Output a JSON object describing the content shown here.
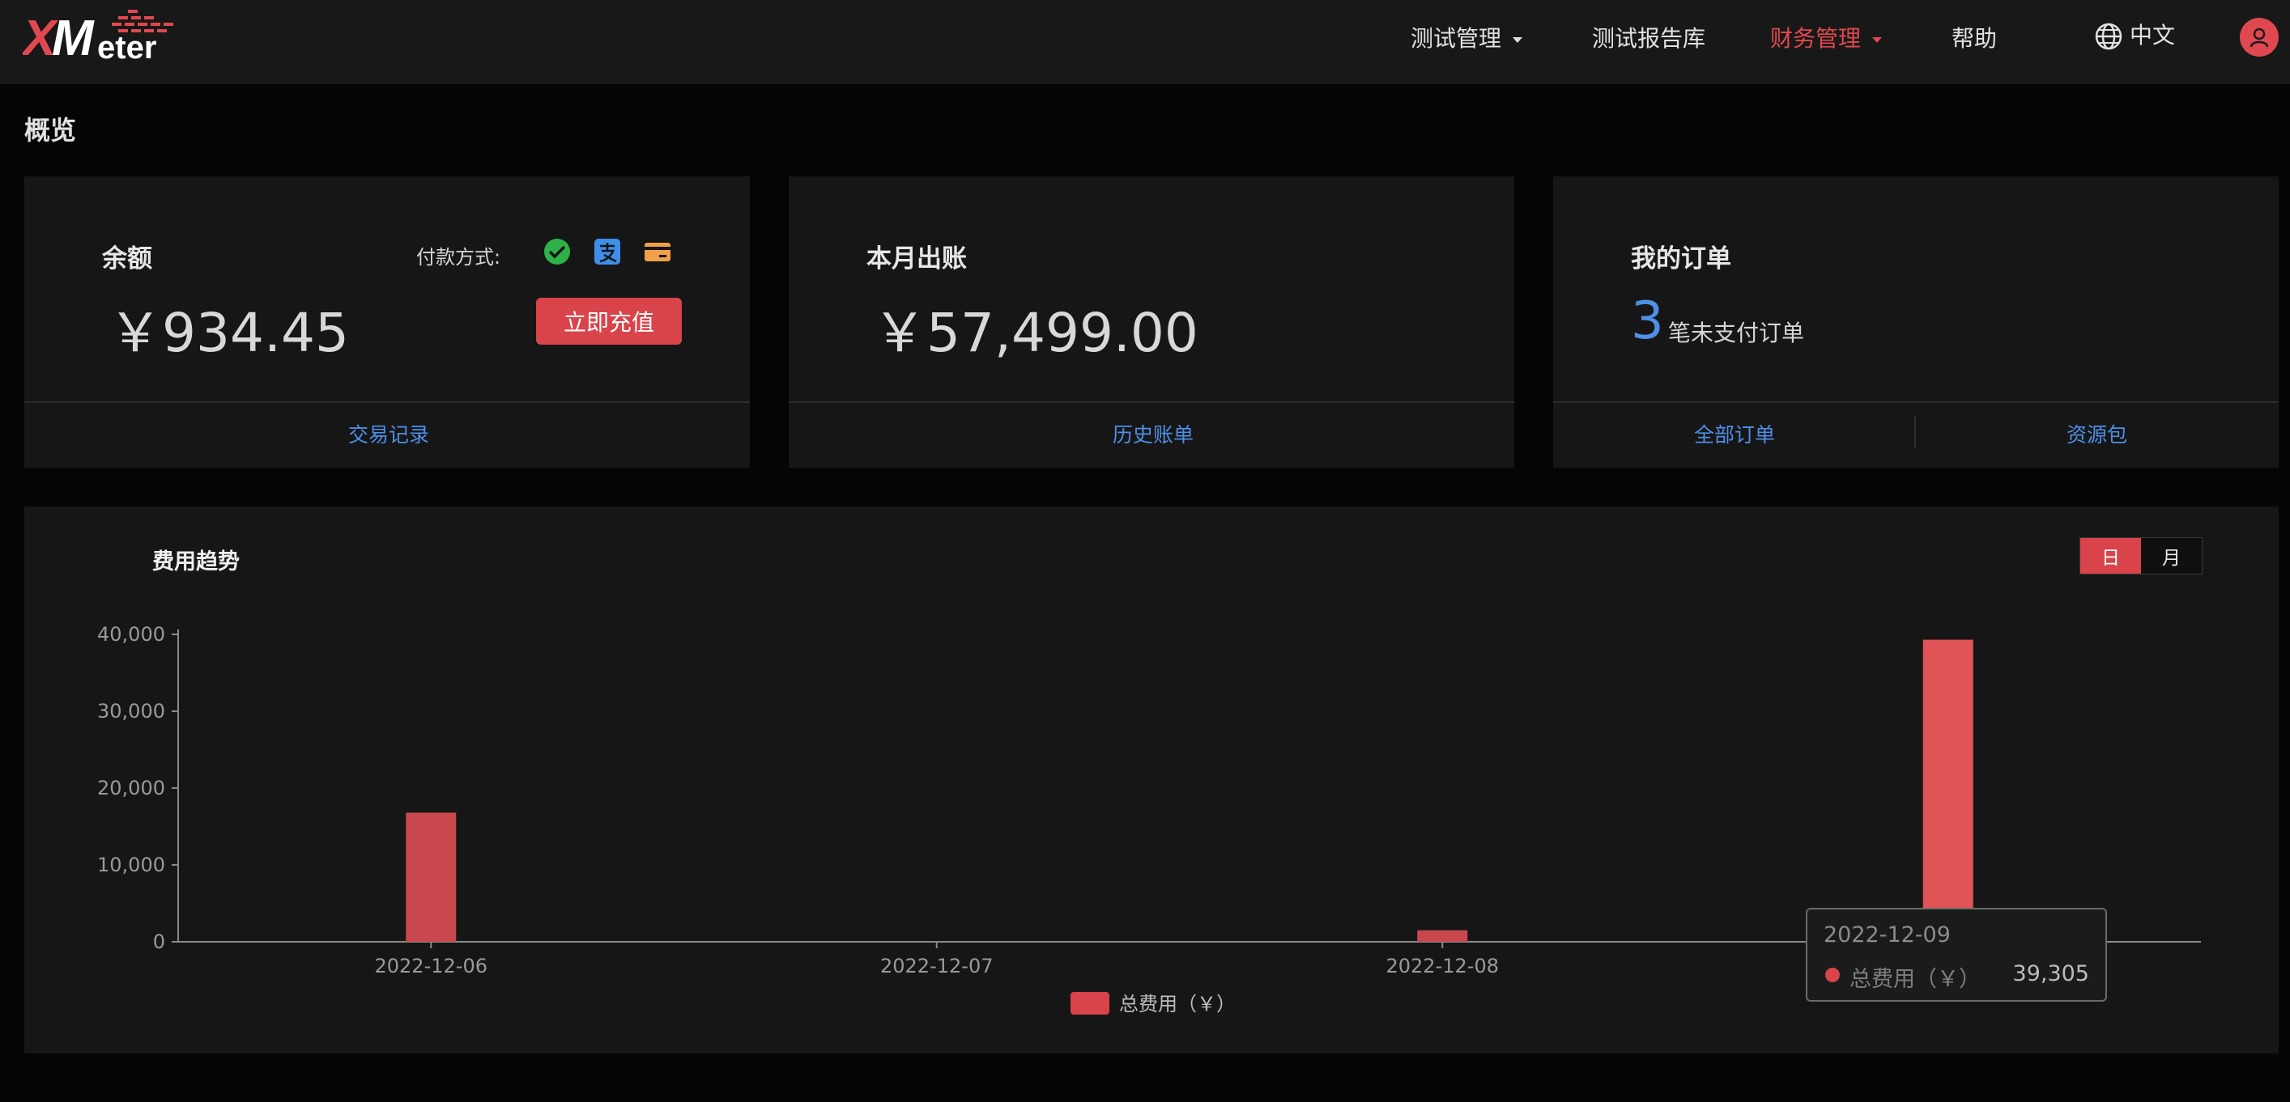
{
  "header": {
    "logo_text": "XMeter",
    "nav": [
      {
        "label": "测试管理",
        "has_dropdown": true,
        "active": false
      },
      {
        "label": "测试报告库",
        "has_dropdown": false,
        "active": false
      },
      {
        "label": "财务管理",
        "has_dropdown": true,
        "active": true
      },
      {
        "label": "帮助",
        "has_dropdown": false,
        "active": false
      }
    ],
    "language": "中文",
    "language_icon": "globe-icon",
    "user_icon": "user-icon"
  },
  "page_title": "概览",
  "balance_card": {
    "title": "余额",
    "payment_label": "付款方式:",
    "payment_icons": [
      "wechat-pay-icon",
      "alipay-icon",
      "bank-card-icon"
    ],
    "amount": "￥934.45",
    "recharge_button": "立即充值",
    "footer_link": "交易记录"
  },
  "monthly_card": {
    "title": "本月出账",
    "amount": "￥57,499.00",
    "footer_link": "历史账单"
  },
  "orders_card": {
    "title": "我的订单",
    "count": "3",
    "count_text": "笔未支付订单",
    "footer_links": [
      "全部订单",
      "资源包"
    ]
  },
  "trend_panel": {
    "title": "费用趋势",
    "toggle": [
      "日",
      "月"
    ],
    "toggle_active": "日",
    "tooltip": {
      "date": "2022-12-09",
      "series": "总费用（￥）",
      "value": "39,305"
    }
  },
  "chart_data": {
    "type": "bar",
    "categories": [
      "2022-12-06",
      "2022-12-07",
      "2022-12-08",
      "2022-12-09"
    ],
    "series": [
      {
        "name": "总费用（￥）",
        "values": [
          16800,
          0,
          1500,
          39305
        ]
      }
    ],
    "yticks": [
      "0",
      "10,000",
      "20,000",
      "30,000",
      "40,000"
    ],
    "ylim": [
      0,
      40000
    ],
    "legend_position": "bottom-center",
    "grid": false
  },
  "colors": {
    "accent": "#d9434a",
    "link": "#4e8fe6",
    "background": "#050505",
    "card": "#161616"
  }
}
